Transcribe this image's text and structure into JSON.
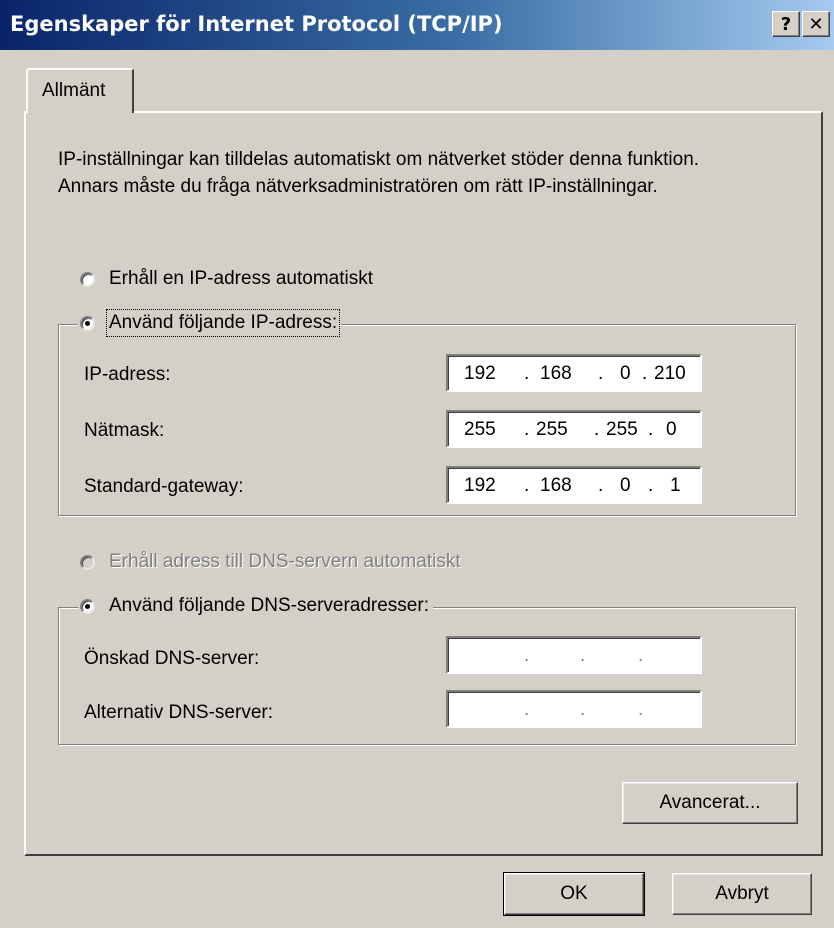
{
  "window": {
    "title": "Egenskaper för Internet Protocol (TCP/IP)",
    "help_label": "?",
    "close_label": "✕"
  },
  "tabs": [
    {
      "label": "Allmänt",
      "selected": true
    }
  ],
  "description": "IP-inställningar kan tilldelas automatiskt om nätverket stöder denna funktion. Annars måste du fråga nätverksadministratören om rätt IP-inställningar.",
  "ip_section": {
    "auto_option": {
      "label": "Erhåll en IP-adress automatiskt",
      "selected": false
    },
    "manual_option": {
      "label": "Använd följande IP-adress:",
      "selected": true
    },
    "fields": [
      {
        "label": "IP-adress:",
        "octets": [
          "192",
          "168",
          "0",
          "210"
        ]
      },
      {
        "label": "Nätmask:",
        "octets": [
          "255",
          "255",
          "255",
          "0"
        ]
      },
      {
        "label": "Standard-gateway:",
        "octets": [
          "192",
          "168",
          "0",
          "1"
        ]
      }
    ]
  },
  "dns_section": {
    "auto_option": {
      "label": "Erhåll adress till DNS-servern automatiskt",
      "selected": false,
      "disabled": true
    },
    "manual_option": {
      "label": "Använd följande DNS-serveradresser:",
      "selected": true
    },
    "fields": [
      {
        "label": "Önskad DNS-server:",
        "octets": [
          "",
          "",
          "",
          ""
        ]
      },
      {
        "label": "Alternativ DNS-server:",
        "octets": [
          "",
          "",
          "",
          ""
        ]
      }
    ]
  },
  "buttons": {
    "advanced": "Avancerat...",
    "ok": "OK",
    "cancel": "Avbryt"
  },
  "colors": {
    "dialog_bg": "#d4d0c8",
    "title_gradient_start": "#0a246a",
    "title_gradient_end": "#a6caf0"
  }
}
